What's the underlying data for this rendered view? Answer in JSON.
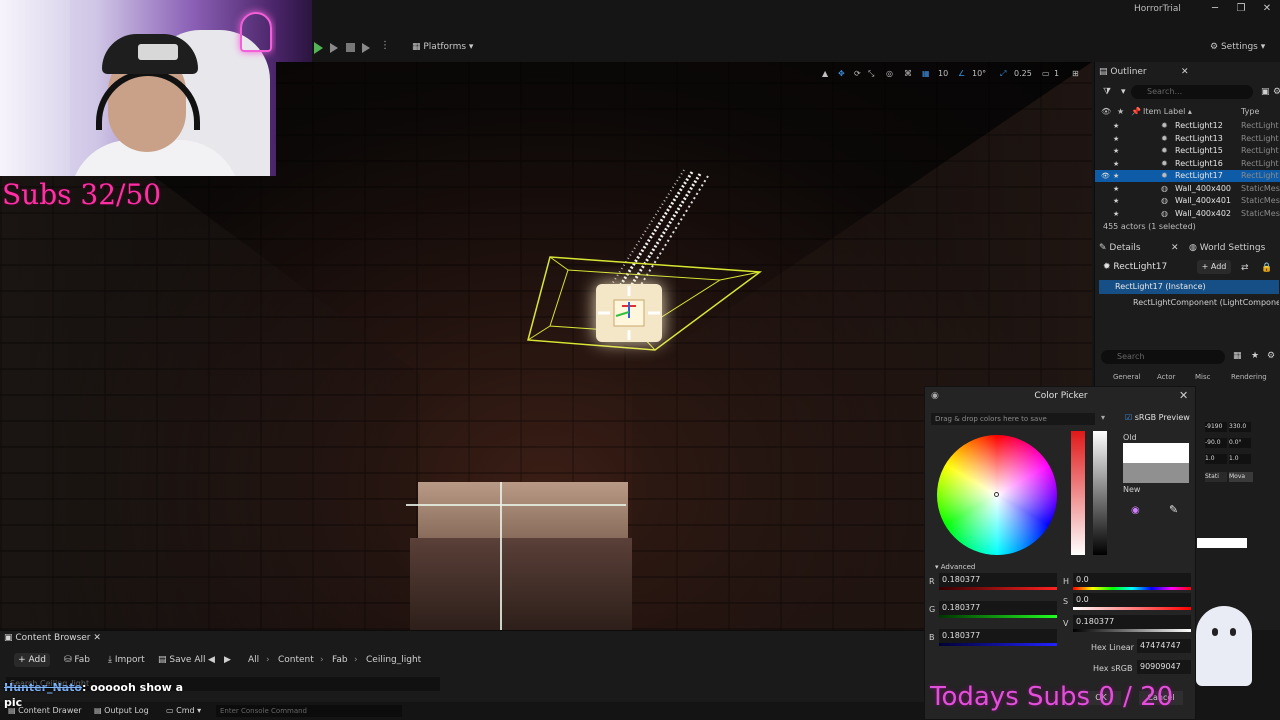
{
  "window": {
    "title": "HorrorTrial"
  },
  "toolbar": {
    "platforms_label": "Platforms",
    "settings_label": "Settings"
  },
  "viewport": {
    "grid_snap": "10",
    "rotation_snap": "10°",
    "scale_snap": "0.25",
    "camera_speed": "1"
  },
  "stream": {
    "subs_goal": "Subs 32/50",
    "todays_subs": "Todays Subs  0 / 20",
    "chat_user": "Hunter_Nato",
    "chat_message": ": oooooh show a pic"
  },
  "outliner": {
    "tab_label": "Outliner",
    "search_placeholder": "Search...",
    "col_label": "Item Label ▴",
    "col_type": "Type",
    "rows": [
      {
        "name": "RectLight12",
        "type": "RectLight",
        "icon": "light-icon"
      },
      {
        "name": "RectLight13",
        "type": "RectLight",
        "icon": "light-icon"
      },
      {
        "name": "RectLight15",
        "type": "RectLight",
        "icon": "light-icon"
      },
      {
        "name": "RectLight16",
        "type": "RectLight",
        "icon": "light-icon"
      },
      {
        "name": "RectLight17",
        "type": "RectLight",
        "icon": "light-icon",
        "selected": true
      },
      {
        "name": "Wall_400x400",
        "type": "StaticMesh",
        "icon": "mesh-icon"
      },
      {
        "name": "Wall_400x401",
        "type": "StaticMesh",
        "icon": "mesh-icon"
      },
      {
        "name": "Wall_400x402",
        "type": "StaticMesh",
        "icon": "mesh-icon"
      }
    ],
    "count": "455 actors (1 selected)"
  },
  "details": {
    "tab_label": "Details",
    "world_settings_label": "World Settings",
    "selected_name": "RectLight17",
    "add_label": "+ Add",
    "instance_label": "RectLight17 (Instance)",
    "component_label": "RectLightComponent (LightComponent)",
    "search_placeholder": "Search",
    "categories": [
      "General",
      "Actor",
      "Misc",
      "Rendering"
    ],
    "transform": {
      "location": [
        "-9190",
        "330.0"
      ],
      "rotation": [
        "-90.0",
        "0.0°"
      ],
      "scale": [
        "1.0",
        "1.0"
      ],
      "mobility": [
        "Stati",
        "Mova"
      ]
    }
  },
  "color_picker": {
    "title": "Color Picker",
    "drag_hint": "Drag & drop colors here to save",
    "srgb_preview_label": "sRGB Preview",
    "srgb_preview_checked": true,
    "old_label": "Old",
    "new_label": "New",
    "advanced_label": "Advanced",
    "old_color": "#ffffff",
    "new_color": "#909090",
    "r": "0.180377",
    "g": "0.180377",
    "b": "0.180377",
    "h": "0.0",
    "s": "0.0",
    "v": "0.180377",
    "hex_linear_label": "Hex Linear",
    "hex_linear": "47474747",
    "hex_srgb_label": "Hex sRGB",
    "hex_srgb": "90909047",
    "ok_label": "OK",
    "cancel_label": "Cancel"
  },
  "content_browser": {
    "tab_label": "Content Browser",
    "add_label": "+ Add",
    "fab_label": "Fab",
    "import_label": "Import",
    "save_all_label": "Save All",
    "breadcrumb": [
      "All",
      "Content",
      "Fab",
      "Ceiling_light"
    ],
    "search_placeholder": "Search Ceiling_light"
  },
  "statusbar": {
    "content_drawer_label": "Content Drawer",
    "output_log_label": "Output Log",
    "cmd_label": "Cmd",
    "console_placeholder": "Enter Console Command"
  }
}
